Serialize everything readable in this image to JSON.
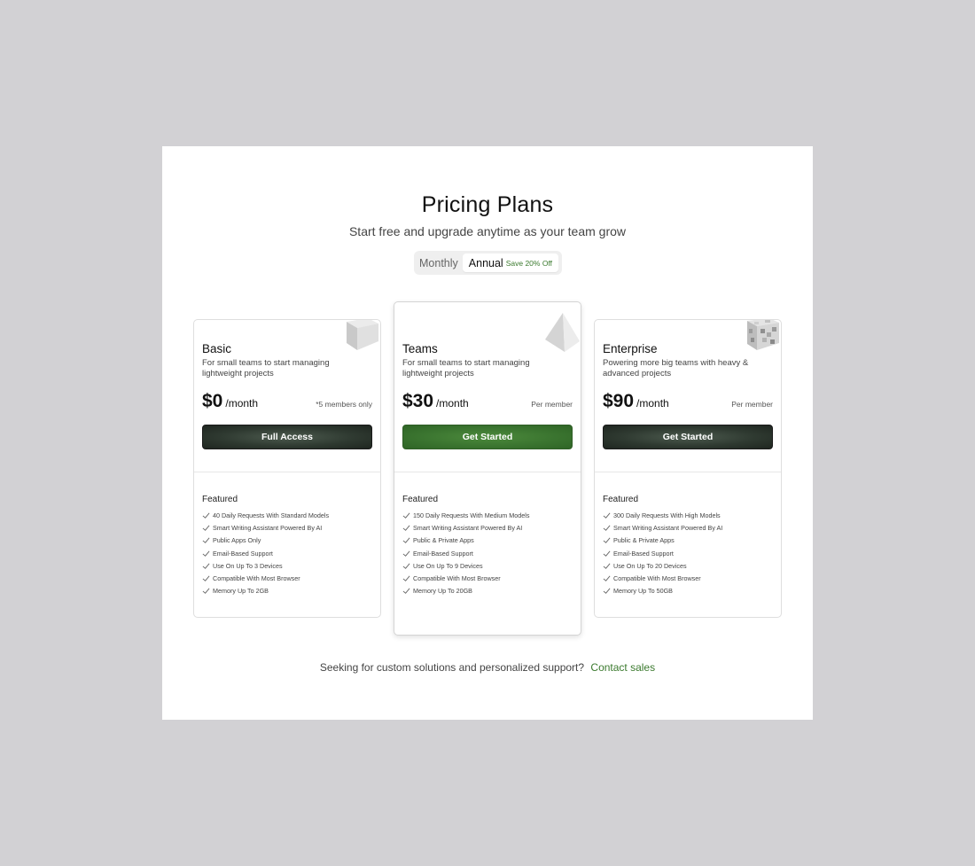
{
  "header": {
    "title": "Pricing Plans",
    "subtitle": "Start free and upgrade anytime as your team grow"
  },
  "billing_toggle": {
    "monthly_label": "Monthly",
    "annual_label": "Annual",
    "annual_badge": "Save 20% Off",
    "selected": "Annual"
  },
  "plans": [
    {
      "name": "Basic",
      "description": "For small teams to start managing lightweight projects",
      "price": "$0",
      "period": "/month",
      "note": "*5 members only",
      "cta": "Full Access",
      "features_title": "Featured",
      "features": [
        "40 Daily Requests With Standard Models",
        "Smart Writing Assistant Powered By AI",
        "Public Apps Only",
        "Email-Based Support",
        "Use On Up To 3 Devices",
        "Compatible With Most Browser",
        "Memory Up To 2GB"
      ],
      "icon": "cube-icon"
    },
    {
      "name": "Teams",
      "description": "For small teams to start managing lightweight projects",
      "price": "$30",
      "period": "/month",
      "note": "Per member",
      "cta": "Get Started",
      "features_title": "Featured",
      "features": [
        "150 Daily Requests With Medium Models",
        "Smart Writing Assistant Powered By AI",
        "Public & Private Apps",
        "Email-Based Support",
        "Use On Up To 9 Devices",
        "Compatible With Most Browser",
        "Memory Up To 20GB"
      ],
      "icon": "pyramid-icon",
      "highlighted": true
    },
    {
      "name": "Enterprise",
      "description": "Powering more big teams with heavy & advanced projects",
      "price": "$90",
      "period": "/month",
      "note": "Per member",
      "cta": "Get Started",
      "features_title": "Featured",
      "features": [
        "300 Daily Requests With High Models",
        "Smart Writing Assistant Powered By AI",
        "Public & Private Apps",
        "Email-Based Support",
        "Use On Up To 20 Devices",
        "Compatible With Most Browser",
        "Memory Up To 50GB"
      ],
      "icon": "voxel-cube-icon"
    }
  ],
  "footer": {
    "text": "Seeking for custom solutions and personalized support?",
    "link": "Contact sales"
  },
  "colors": {
    "accent_green": "#3b7a2e",
    "dark_button": "#2f3a31",
    "page_background": "#d2d1d4"
  }
}
